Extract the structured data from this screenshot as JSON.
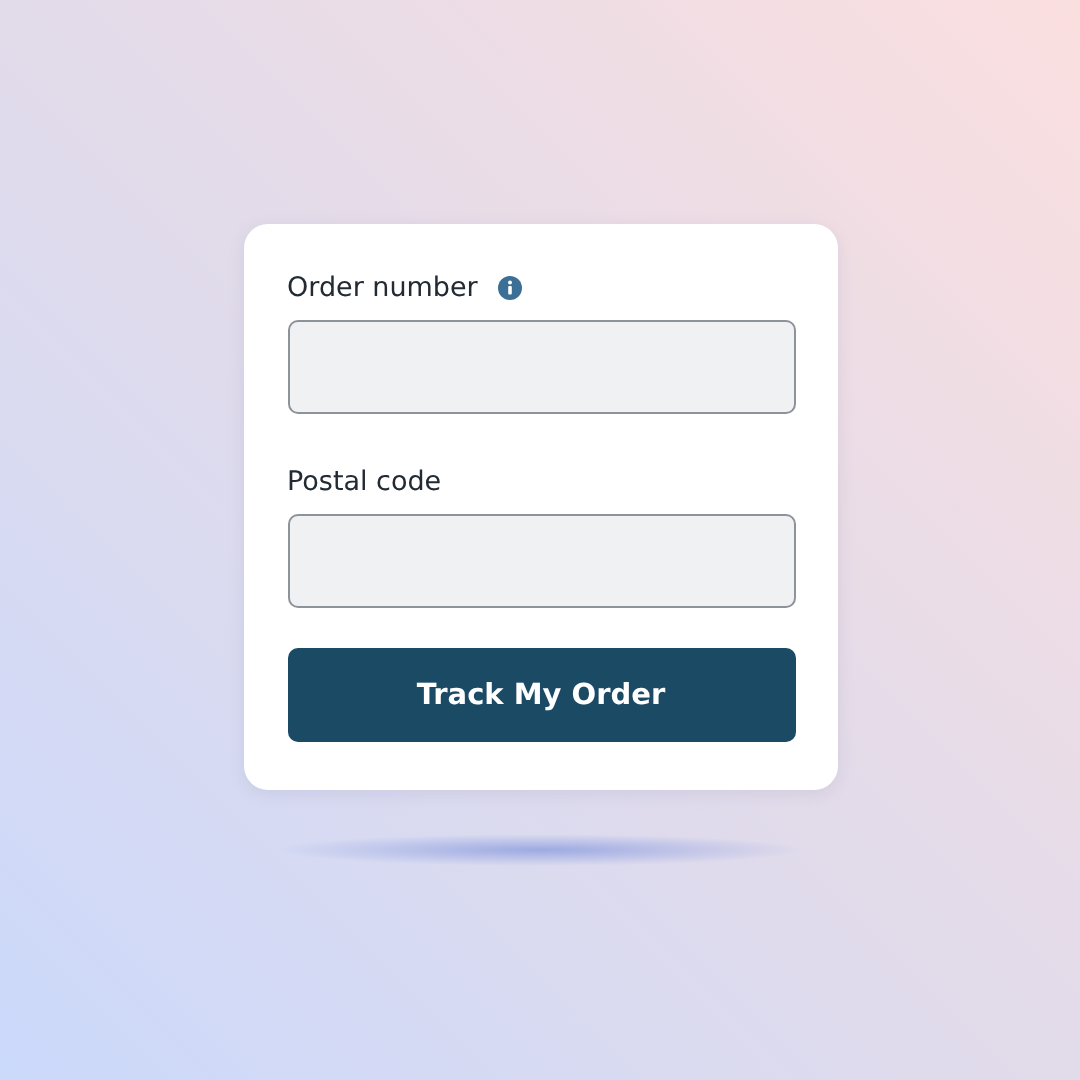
{
  "fields": [
    {
      "label": "Order number",
      "info": true
    },
    {
      "label": "Postal code",
      "info": false
    }
  ],
  "button": {
    "label": "Track My Order"
  }
}
